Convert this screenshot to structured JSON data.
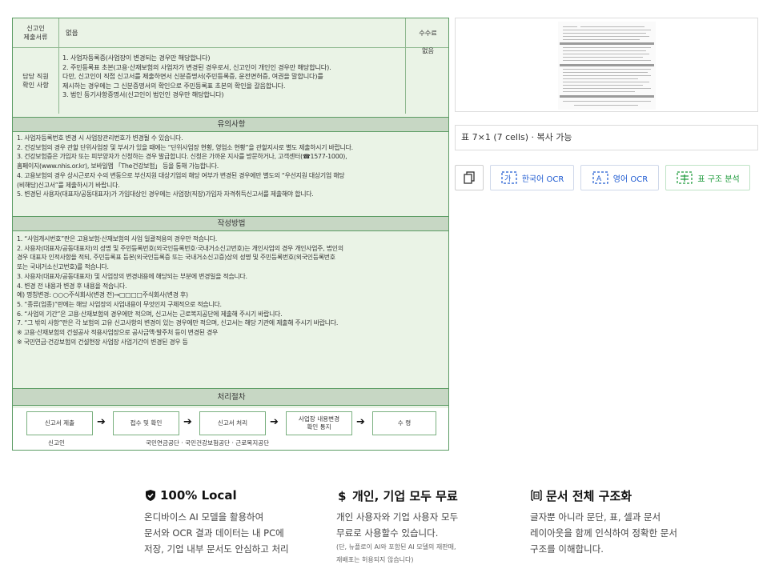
{
  "document": {
    "row1": {
      "label_line1": "신고인",
      "label_line2": "제출서류",
      "content": "없음",
      "fee_label": "수수료"
    },
    "row2": {
      "label_line1": "담당 직원",
      "label_line2": "확인 사항",
      "fee_value": "없음",
      "lines": [
        "1. 사업자등록증(사업장이 변경되는 경우만 해당합니다)",
        "2. 주민등록표 초본(고용·산재보험의 사업자가 변경된 경우로서, 신고인이 개인인 경우만 해당합니다).",
        "   다만, 신고인이 직접 신고서를 제출하면서 신분증명서(주민등록증, 운전면허증, 여권을 말합니다)를",
        "   제시하는 경우에는 그 신분증명서의 확인으로 주민등록표 초본의 확인을 갈음합니다.",
        "3. 법인 등기사항증명서(신고인이 법인인 경우만 해당합니다)"
      ]
    },
    "notes": {
      "title": "유의사항",
      "lines": [
        "1. 사업자등록번호 변경 시 사업장관리번호가 변경될 수 있습니다.",
        "2. 건강보험의 경우 관할 단위사업장 및 부서가 있을 때에는 “단위사업장 현황, 영업소 현황”을 관할지사로 별도 제출하시기 바랍니다.",
        "3. 건강보험증은 가입자 또는 피부양자가 신청하는 경우 발급합니다. 신청은 가까운 지사를 방문하거나, 고객센터(☎1577-1000),",
        "   홈페이지(www.nhis.or.kr), 보바일앱 「The건강보험」 등을 통해 가능합니다.",
        "4. 고용보험의 경우 상시근로자 수의 변동으로 부신지원 대상기업의 해당 여부가 변경된 경우에만 별도의 “우선지원 대상기업 해당",
        "   (비해당)신고서”를 제출하시기 바랍니다.",
        "5. 변경된 사용자(대표자/공동대표자)가 가입대상인 경우에는 사업장(직장)가입자 자격취득신고서를 제출해야 합니다."
      ]
    },
    "method": {
      "title": "작성방법",
      "lines": [
        "1. “사업개시번호”란은 고용보험·산재보험의 사업 일괄적용의 경우만 적습니다.",
        "2. 사용자(대표자/공동대표자)의 성명 및 주민등록번호(외국인등록번호·국내거소신고번호)는 개인사업의 경우 개인사업주, 법인의",
        "   경우 대표자 인적사항을 적되, 주민등록표 등본(외국인등록증 또는 국내거소신고증)상의 성명 및 주민등록번호(외국인등록번호",
        "   또는 국내거소신고번호)를 적습니다.",
        "3. 사용자(대표자/공동대표자) 및 사업장의 변경내용에 해당되는 부분에 변경일을 적습니다.",
        "4. 변경 전 내용과 변경 후 내용을 적습니다.",
        "   예) 명칭변경: ○○○주식회사(변경 전)→□□□□주식회사(변경 후)",
        "5. “종류(업종)”란에는 해당 사업장의 사업내용이 무엇인지 구체적으로 적습니다.",
        "6. “사업의 기간”은 고용·산재보험의 경우에만 적으며, 신고서는 근로복지공단에 제출해 주시기 바랍니다.",
        "7. “그 밖의 사항”란은 각 보험의 고유 신고사항의 변경이 있는 경우에만 적으며, 신고서는 해당 기관에 제출해 주시기 바랍니다.",
        "   ※ 고용·산재보험의 건설공사 적용사업장으로 공사금액·발주처 등이 변경된 경우",
        "   ※ 국민연금·건강보험의 건설현장 사업장 사업기간이 변경된 경우 등"
      ]
    },
    "process": {
      "title": "처리절차",
      "steps": [
        "신고서 제출",
        "접수 및 확인",
        "신고서 처리",
        "사업장 내용변경",
        "확인 통지",
        "수 령"
      ],
      "under_left": "신고인",
      "under_center": "국민연금공단 · 국민건강보험공단 · 근로복지공단"
    }
  },
  "panel": {
    "table_info": "표 7×1 (7 cells) · 복사 가능",
    "btn_korean_ocr": "한국어 OCR",
    "btn_english_ocr": "영어 OCR",
    "btn_table_analysis": "표 구조 분석",
    "icons": {
      "copy": "copy-icon",
      "korean_ocr": "korean-ocr-icon",
      "english_ocr": "english-ocr-icon",
      "table": "table-structure-icon"
    },
    "colors": {
      "blue": "#1f5bd1",
      "green": "#1c9a3a"
    }
  },
  "features": [
    {
      "title": "100% Local",
      "desc1": "온디바이스 AI 모델을 활용하여",
      "desc2": "문서와 OCR 결과 데이터는 내 PC에",
      "desc3": "저장, 기업 내부 문서도 안심하고 처리"
    },
    {
      "title": "개인, 기업 모두 무료",
      "desc1": "개인 사용자와 기업 사용자 모두",
      "desc2": "무료로 사용할수 있습니다.",
      "note1": "(단, 뉴플로이 AI와 포함된 AI 모델의 재판매,",
      "note2": "재배포는 허용되지 않습니다)"
    },
    {
      "title": "문서 전체 구조화",
      "desc1": "글자뿐 아니라 문단, 표, 셀과 문서",
      "desc2": "레이아웃을 함께 인식하여 정확한 문서",
      "desc3": "구조를 이해합니다."
    }
  ]
}
